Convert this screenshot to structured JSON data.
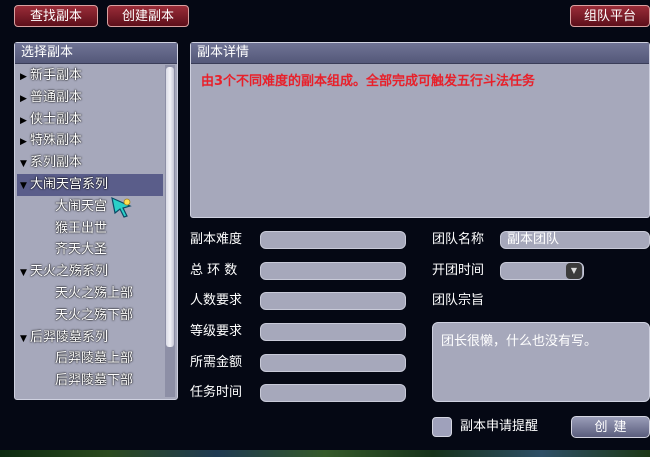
{
  "top_buttons": {
    "find_dungeon": "查找副本",
    "create_dungeon": "创建副本",
    "team_platform": "组队平台"
  },
  "left_panel": {
    "header": "选择副本",
    "items": [
      {
        "label": "新手副本",
        "arrow": "▶",
        "indent": 0
      },
      {
        "label": "普通副本",
        "arrow": "▶",
        "indent": 0
      },
      {
        "label": "侠士副本",
        "arrow": "▶",
        "indent": 0
      },
      {
        "label": "特殊副本",
        "arrow": "▶",
        "indent": 0
      },
      {
        "label": "系列副本",
        "arrow": "▼",
        "indent": 0
      },
      {
        "label": "大闹天宫系列",
        "arrow": "▼",
        "indent": 0,
        "selected": true
      },
      {
        "label": "大闹天宫",
        "arrow": "",
        "indent": 2
      },
      {
        "label": "猴王出世",
        "arrow": "",
        "indent": 2
      },
      {
        "label": "齐天大圣",
        "arrow": "",
        "indent": 2
      },
      {
        "label": "天火之殇系列",
        "arrow": "▼",
        "indent": 0
      },
      {
        "label": "天火之殇上部",
        "arrow": "",
        "indent": 2
      },
      {
        "label": "天火之殇下部",
        "arrow": "",
        "indent": 2
      },
      {
        "label": "后羿陵墓系列",
        "arrow": "▼",
        "indent": 0
      },
      {
        "label": "后羿陵墓上部",
        "arrow": "",
        "indent": 2
      },
      {
        "label": "后羿陵墓下部",
        "arrow": "",
        "indent": 2
      }
    ]
  },
  "detail_panel": {
    "header": "副本详情",
    "description": "由3个不同难度的副本组成。全部完成可触发五行斗法任务",
    "description_color": "#e8202a"
  },
  "form": {
    "difficulty_label": "副本难度",
    "difficulty_value": "",
    "rounds_label": "总 环 数",
    "rounds_value": "",
    "people_label": "人数要求",
    "people_value": "",
    "level_label": "等级要求",
    "level_value": "",
    "gold_label": "所需金额",
    "gold_value": "",
    "time_label": "任务时间",
    "time_value": "",
    "team_name_label": "团队名称",
    "team_name_value": "副本团队",
    "open_time_label": "开团时间",
    "open_time_value": "",
    "motto_label": "团队宗旨",
    "motto_value": "团长很懒，什么也没有写。"
  },
  "footer": {
    "reminder_label": "副本申请提醒",
    "reminder_checked": false,
    "create_label": "创建"
  }
}
